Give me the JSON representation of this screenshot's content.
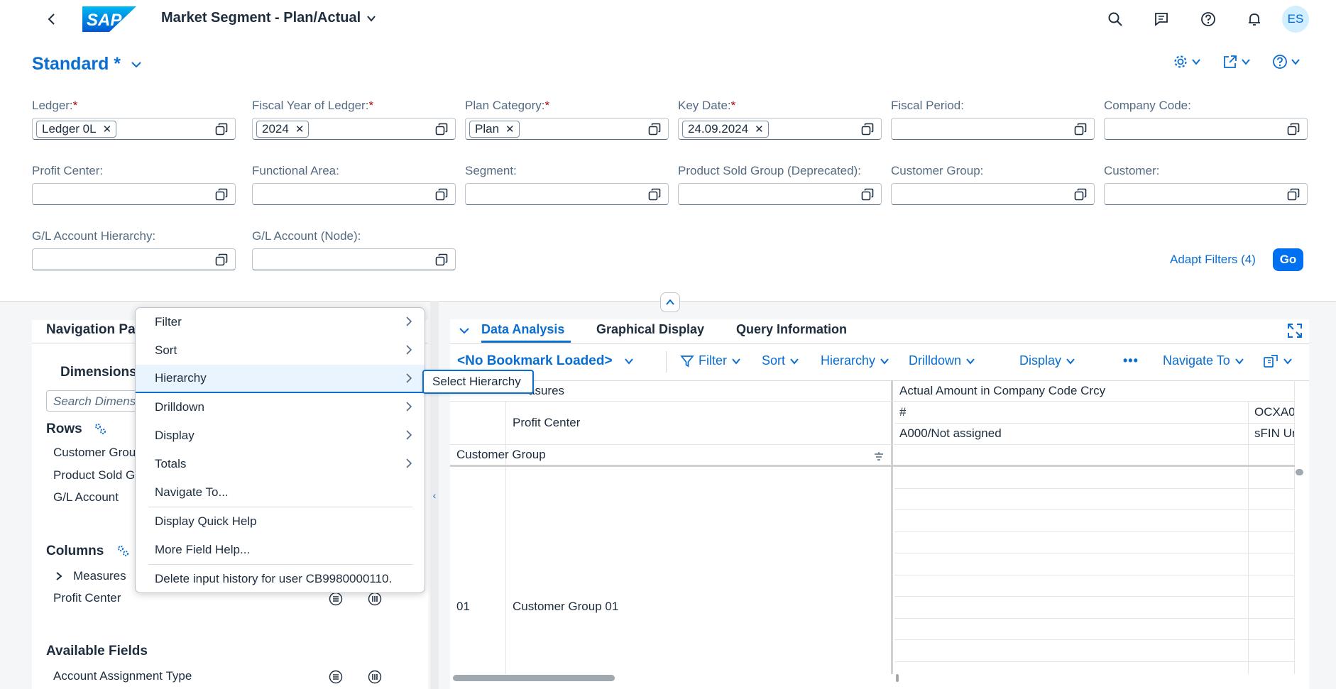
{
  "shell": {
    "app_title": "Market Segment - Plan/Actual",
    "avatar_initials": "ES",
    "logo_text": "SAP"
  },
  "header": {
    "variant_name": "Standard *"
  },
  "filters": {
    "ledger": {
      "label": "Ledger:",
      "required": "*",
      "token": "Ledger 0L"
    },
    "fiscal_year": {
      "label": "Fiscal Year of Ledger:",
      "required": "*",
      "token": "2024"
    },
    "plan_category": {
      "label": "Plan Category:",
      "required": "*",
      "token": "Plan"
    },
    "key_date": {
      "label": "Key Date:",
      "required": "*",
      "token": "24.09.2024"
    },
    "fiscal_period": {
      "label": "Fiscal Period:"
    },
    "company_code": {
      "label": "Company Code:"
    },
    "profit_center": {
      "label": "Profit Center:"
    },
    "functional_area": {
      "label": "Functional Area:"
    },
    "segment": {
      "label": "Segment:"
    },
    "product_sold_group": {
      "label": "Product Sold Group (Deprecated):"
    },
    "customer_group": {
      "label": "Customer Group:"
    },
    "customer": {
      "label": "Customer:"
    },
    "gl_account_hierarchy": {
      "label": "G/L Account Hierarchy:"
    },
    "gl_account_node": {
      "label": "G/L Account (Node):"
    },
    "adapt_filters": "Adapt Filters (4)",
    "go": "Go"
  },
  "nav_panel": {
    "title": "Navigation Pa",
    "dimensions_tab": "Dimensions",
    "search_placeholder": "Search Dimens",
    "rows_label": "Rows",
    "rows": [
      "Customer Grou",
      "Product Sold G",
      "G/L Account"
    ],
    "columns_label": "Columns",
    "columns": [
      "Measures",
      "Profit Center"
    ],
    "available_label": "Available Fields",
    "available": [
      "Account Assignment Type"
    ]
  },
  "context_menu": {
    "items": [
      "Filter",
      "Sort",
      "Hierarchy",
      "Drilldown",
      "Display",
      "Totals",
      "Navigate To...",
      "Display Quick Help",
      "More Field Help...",
      "Delete input history for user CB9980000110."
    ],
    "submenu_item": "Select Hierarchy"
  },
  "analysis": {
    "tabs": [
      "Data Analysis",
      "Graphical Display",
      "Query Information"
    ],
    "bookmark": "<No Bookmark Loaded>",
    "toolbar": [
      "Filter",
      "Sort",
      "Hierarchy",
      "Drilldown",
      "Display",
      "Navigate To"
    ],
    "more_glyph": "•••",
    "grid": {
      "measures_label": "asures",
      "profit_center_label": "Profit Center",
      "customer_group_label": "Customer Group",
      "col_header": "Actual Amount in Company Code Crcy",
      "hash": "#",
      "col2_top": "OCXA0",
      "not_assigned": "A000/Not assigned",
      "col2_bottom": "sFIN Ur",
      "row_key": "01",
      "row_text": "Customer Group 01"
    }
  },
  "colors": {
    "accent": "#0a6ed1",
    "go_button": "#0070f2",
    "required": "#aa0808",
    "avatar_bg": "#d1efff"
  }
}
